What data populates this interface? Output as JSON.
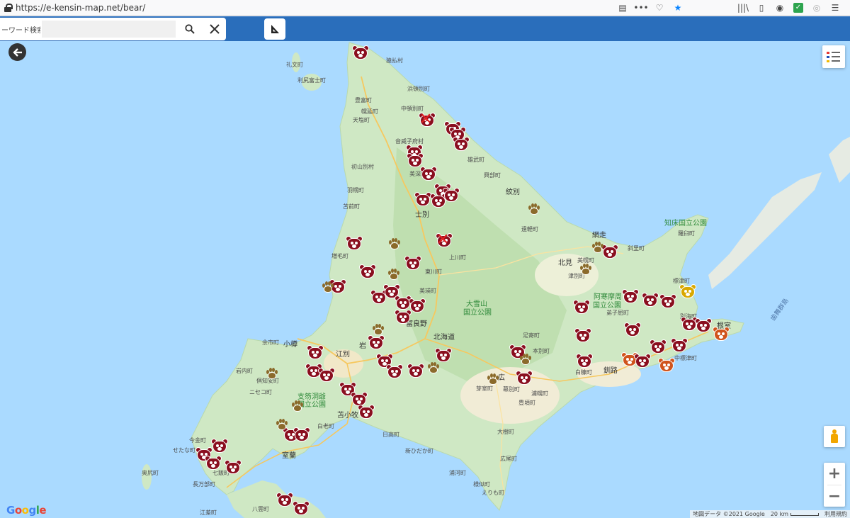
{
  "browser": {
    "url": "https://e-kensin-map.net/bear/",
    "icons_left": [
      "reader-icon",
      "more-icon",
      "pocket-icon",
      "bookmark-star-icon"
    ],
    "icons_right": [
      "library-icon",
      "sidebar-icon",
      "account-icon",
      "extension-check-icon",
      "extension-icon",
      "menu-icon"
    ],
    "glyphs": {
      "reader": "▤",
      "more": "•••",
      "pocket": "♡",
      "star": "★",
      "library": "|||\\",
      "sidebar": "▯",
      "account": "◉",
      "check": "✓",
      "ext": "◎",
      "menu": "☰"
    }
  },
  "toolbar": {
    "search_label": "ーワード検索",
    "search_value": "",
    "search_glyph": "🔍",
    "clear_glyph": "✕",
    "measure_glyph": "◣"
  },
  "map": {
    "back_glyph": "➜",
    "zoom_in": "+",
    "zoom_out": "−",
    "attribution": "地図データ ©2021 Google",
    "scale": "20 km",
    "terms": "利用規約",
    "google_letters": [
      {
        "ch": "G",
        "color": "#4285f4"
      },
      {
        "ch": "o",
        "color": "#ea4335"
      },
      {
        "ch": "o",
        "color": "#fbbc05"
      },
      {
        "ch": "g",
        "color": "#4285f4"
      },
      {
        "ch": "l",
        "color": "#34a853"
      },
      {
        "ch": "e",
        "color": "#ea4335"
      }
    ],
    "layer_colors": [
      "#e53935",
      "#1e4fb8",
      "#f2b800"
    ],
    "labels": [
      {
        "text": "猿払村",
        "cls": ""
      },
      {
        "text": "礼文町",
        "cls": ""
      },
      {
        "text": "利尻富士町",
        "cls": ""
      },
      {
        "text": "浜頓別町",
        "cls": ""
      },
      {
        "text": "豊富町",
        "cls": ""
      },
      {
        "text": "幌延町",
        "cls": ""
      },
      {
        "text": "中頓別町",
        "cls": ""
      },
      {
        "text": "天塩町",
        "cls": ""
      },
      {
        "text": "音威子府村",
        "cls": ""
      },
      {
        "text": "雄武町",
        "cls": ""
      },
      {
        "text": "初山別村",
        "cls": ""
      },
      {
        "text": "興部町",
        "cls": ""
      },
      {
        "text": "美深町",
        "cls": ""
      },
      {
        "text": "羽幌町",
        "cls": ""
      },
      {
        "text": "紋別",
        "cls": "big"
      },
      {
        "text": "苫前町",
        "cls": ""
      },
      {
        "text": "士別",
        "cls": "big"
      },
      {
        "text": "遠軽町",
        "cls": ""
      },
      {
        "text": "知床国立公園",
        "cls": "park"
      },
      {
        "text": "網走",
        "cls": "big"
      },
      {
        "text": "羅臼町",
        "cls": ""
      },
      {
        "text": "斜里町",
        "cls": ""
      },
      {
        "text": "増毛町",
        "cls": ""
      },
      {
        "text": "上川町",
        "cls": ""
      },
      {
        "text": "北見",
        "cls": "big"
      },
      {
        "text": "美幌町",
        "cls": ""
      },
      {
        "text": "東川町",
        "cls": ""
      },
      {
        "text": "津別町",
        "cls": ""
      },
      {
        "text": "標津町",
        "cls": ""
      },
      {
        "text": "美瑛町",
        "cls": ""
      },
      {
        "text": "大雪山",
        "cls": "park"
      },
      {
        "text": "国立公園",
        "cls": "park"
      },
      {
        "text": "阿寒摩周",
        "cls": "park"
      },
      {
        "text": "国立公園",
        "cls": "park"
      },
      {
        "text": "弟子屈町",
        "cls": ""
      },
      {
        "text": "別海町",
        "cls": ""
      },
      {
        "text": "富良野",
        "cls": "big"
      },
      {
        "text": "北海道",
        "cls": "big"
      },
      {
        "text": "根室",
        "cls": "big"
      },
      {
        "text": "足寄町",
        "cls": ""
      },
      {
        "text": "余市町",
        "cls": ""
      },
      {
        "text": "小樽",
        "cls": "big"
      },
      {
        "text": "江別",
        "cls": "big"
      },
      {
        "text": "岩",
        "cls": "big"
      },
      {
        "text": "本別町",
        "cls": ""
      },
      {
        "text": "岩内町",
        "cls": ""
      },
      {
        "text": "倶知安町",
        "cls": ""
      },
      {
        "text": "白糠町",
        "cls": ""
      },
      {
        "text": "釧路",
        "cls": "big"
      },
      {
        "text": "中標津町",
        "cls": ""
      },
      {
        "text": "芽室町",
        "cls": ""
      },
      {
        "text": "広",
        "cls": "big"
      },
      {
        "text": "幕別町",
        "cls": ""
      },
      {
        "text": "ニセコ町",
        "cls": ""
      },
      {
        "text": "支笏洞爺",
        "cls": "park"
      },
      {
        "text": "国立公園",
        "cls": "park"
      },
      {
        "text": "浦幌町",
        "cls": ""
      },
      {
        "text": "豊頃町",
        "cls": ""
      },
      {
        "text": "苫小牧",
        "cls": "big"
      },
      {
        "text": "白老町",
        "cls": ""
      },
      {
        "text": "大樹町",
        "cls": ""
      },
      {
        "text": "日高町",
        "cls": ""
      },
      {
        "text": "今金町",
        "cls": ""
      },
      {
        "text": "せたな町",
        "cls": ""
      },
      {
        "text": "室蘭",
        "cls": "big"
      },
      {
        "text": "新ひだか町",
        "cls": ""
      },
      {
        "text": "広尾町",
        "cls": ""
      },
      {
        "text": "奥尻町",
        "cls": ""
      },
      {
        "text": "浦河町",
        "cls": ""
      },
      {
        "text": "様似町",
        "cls": ""
      },
      {
        "text": "えりも町",
        "cls": ""
      },
      {
        "text": "八雲町",
        "cls": ""
      },
      {
        "text": "長万部町",
        "cls": ""
      },
      {
        "text": "七飯町",
        "cls": ""
      },
      {
        "text": "江差町",
        "cls": ""
      },
      {
        "text": "歯舞群島",
        "cls": "sea"
      }
    ]
  }
}
